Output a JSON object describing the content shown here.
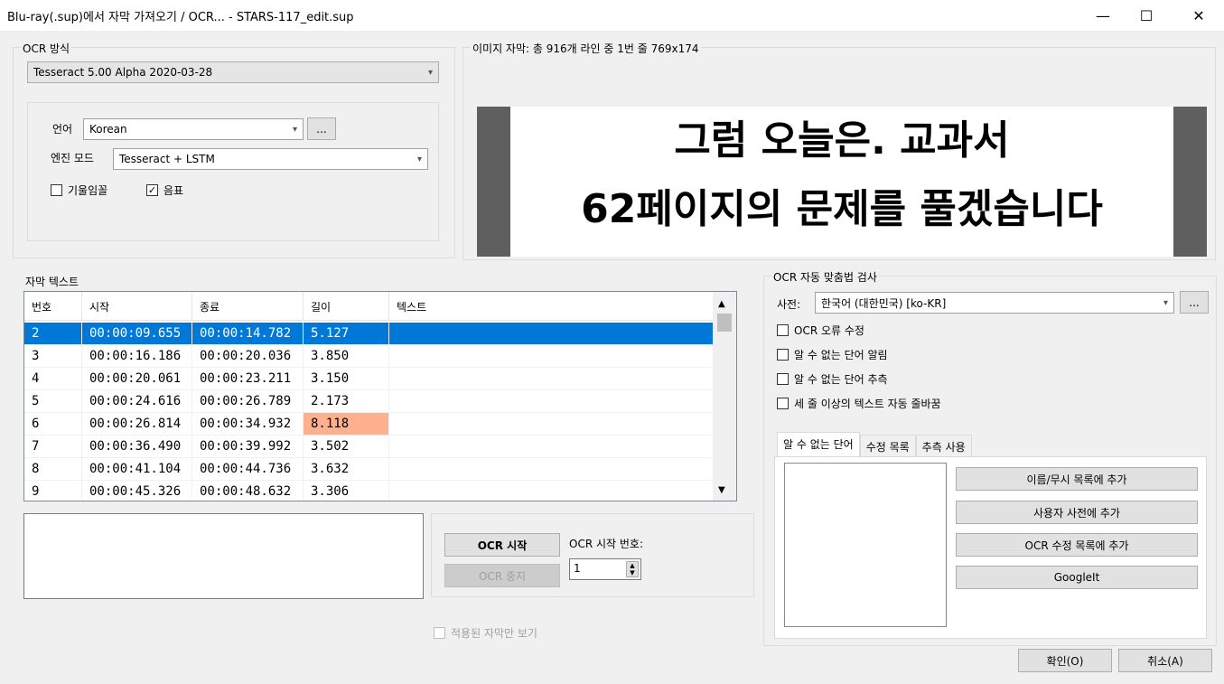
{
  "window": {
    "title": "Blu-ray(.sup)에서 자막 가져오기 / OCR... - STARS-117_edit.sup",
    "minimize": "—",
    "maximize": "☐",
    "close": "✕"
  },
  "ocr_method": {
    "group_label": "OCR 방식",
    "engine_value": "Tesseract 5.00 Alpha 2020-03-28",
    "language_label": "언어",
    "language_value": "Korean",
    "language_more": "...",
    "engine_mode_label": "엔진 모드",
    "engine_mode_value": "Tesseract + LSTM",
    "italic_label": "기울임꼴",
    "italic_checked": false,
    "music_label": "음표",
    "music_checked": true
  },
  "image_subtitle": {
    "group_label": "이미지 자막: 총 916개 라인 중 1번 줄  769x174",
    "line1": "그럼 오늘은. 교과서",
    "line2": "62페이지의 문제를 풀겠습니다"
  },
  "subtitle_text": {
    "group_label": "자막 텍스트",
    "columns": [
      "번호",
      "시작",
      "종료",
      "길이",
      "텍스트"
    ],
    "rows": [
      {
        "n": "2",
        "start": "00:00:09.655",
        "end": "00:00:14.782",
        "dur": "5.127",
        "text": "",
        "selected": true
      },
      {
        "n": "3",
        "start": "00:00:16.186",
        "end": "00:00:20.036",
        "dur": "3.850",
        "text": ""
      },
      {
        "n": "4",
        "start": "00:00:20.061",
        "end": "00:00:23.211",
        "dur": "3.150",
        "text": ""
      },
      {
        "n": "5",
        "start": "00:00:24.616",
        "end": "00:00:26.789",
        "dur": "2.173",
        "text": ""
      },
      {
        "n": "6",
        "start": "00:00:26.814",
        "end": "00:00:34.932",
        "dur": "8.118",
        "text": "",
        "warn": true
      },
      {
        "n": "7",
        "start": "00:00:36.490",
        "end": "00:00:39.992",
        "dur": "3.502",
        "text": ""
      },
      {
        "n": "8",
        "start": "00:00:41.104",
        "end": "00:00:44.736",
        "dur": "3.632",
        "text": ""
      },
      {
        "n": "9",
        "start": "00:00:45.326",
        "end": "00:00:48.632",
        "dur": "3.306",
        "text": ""
      }
    ]
  },
  "ocr_controls": {
    "start_button": "OCR 시작",
    "stop_button": "OCR 중지",
    "start_number_label": "OCR 시작 번호:",
    "start_number_value": "1",
    "show_applied_label": "적용된 자막만 보기"
  },
  "spellcheck": {
    "group_label": "OCR 자동 맞춤법 검사",
    "dictionary_label": "사전:",
    "dictionary_value": "한국어 (대한민국) [ko-KR]",
    "dictionary_more": "...",
    "options": [
      {
        "label": "OCR 오류 수정",
        "checked": false
      },
      {
        "label": "알 수 없는 단어 알림",
        "checked": false
      },
      {
        "label": "알 수 없는 단어 추측",
        "checked": false
      },
      {
        "label": "세 줄 이상의 텍스트 자동 줄바꿈",
        "checked": false
      }
    ],
    "tabs": [
      "알 수 없는 단어",
      "수정 목록",
      "추측 사용"
    ],
    "buttons": [
      "이름/무시 목록에 추가",
      "사용자 사전에 추가",
      "OCR 수정 목록에 추가",
      "GoogleIt"
    ]
  },
  "footer": {
    "ok": "확인(O)",
    "cancel": "취소(A)"
  },
  "colors": {
    "selection": "#0078d7",
    "warning_cell": "#ffb08f"
  }
}
